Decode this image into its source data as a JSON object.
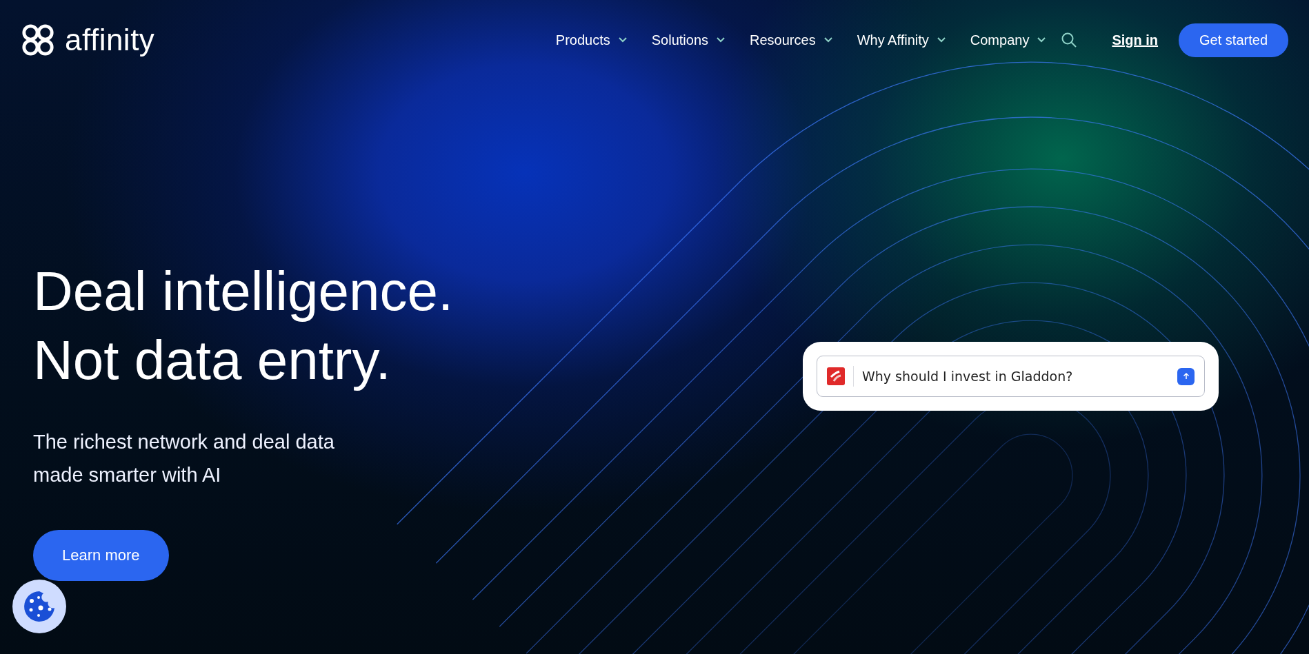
{
  "header": {
    "logo": "affinity",
    "nav": [
      {
        "label": "Products"
      },
      {
        "label": "Solutions"
      },
      {
        "label": "Resources"
      },
      {
        "label": "Why Affinity"
      },
      {
        "label": "Company"
      }
    ],
    "sign_in": "Sign in",
    "cta": "Get started"
  },
  "hero": {
    "headline_lines": [
      "Deal intelligence.",
      "Not data entry."
    ],
    "subtitle": "The richest network and deal data made smarter with AI",
    "button": "Learn more"
  },
  "chat": {
    "value": "Why should I invest in Gladdon?"
  }
}
